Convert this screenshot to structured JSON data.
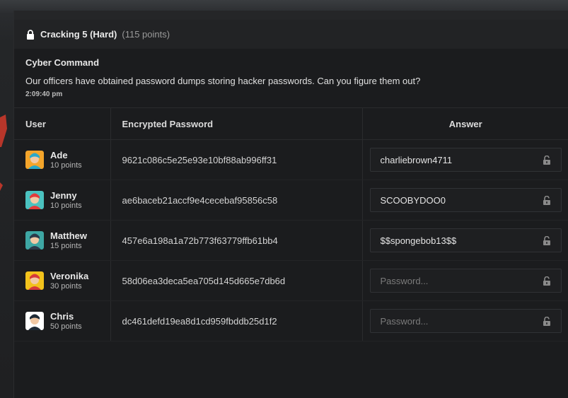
{
  "challenge": {
    "title": "Cracking 5 (Hard)",
    "points": "(115 points)",
    "author": "Cyber Command",
    "message": "Our officers have obtained password dumps storing hacker passwords. Can you figure them out?",
    "time": "2:09:40 pm"
  },
  "table": {
    "headers": {
      "user": "User",
      "password": "Encrypted Password",
      "answer": "Answer"
    },
    "rows": [
      {
        "name": "Ade",
        "points": "10 points",
        "hash": "9621c086c5e25e93e10bf88ab996ff31",
        "answer": "charliebrown4711",
        "placeholder": "Password...",
        "avatar_bg": "#f4a52b",
        "avatar_hair": "#2aa8c9"
      },
      {
        "name": "Jenny",
        "points": "10 points",
        "hash": "ae6baceb21accf9e4cecebaf95856c58",
        "answer": "SCOOBYDOO0",
        "placeholder": "Password...",
        "avatar_bg": "#4bc2c0",
        "avatar_hair": "#e23b3b"
      },
      {
        "name": "Matthew",
        "points": "15 points",
        "hash": "457e6a198a1a72b773f63779ffb61bb4",
        "answer": "$$spongebob13$$",
        "placeholder": "Password...",
        "avatar_bg": "#3ea7a4",
        "avatar_hair": "#2b3a4a"
      },
      {
        "name": "Veronika",
        "points": "30 points",
        "hash": "58d06ea3deca5ea705d145d665e7db6d",
        "answer": "",
        "placeholder": "Password...",
        "avatar_bg": "#f2c21c",
        "avatar_hair": "#d63a3a"
      },
      {
        "name": "Chris",
        "points": "50 points",
        "hash": "dc461defd19ea8d1cd959fbddb25d1f2",
        "answer": "",
        "placeholder": "Password...",
        "avatar_bg": "#ffffff",
        "avatar_hair": "#1e2a36"
      }
    ]
  },
  "colors": {
    "lock": "#ffffff",
    "unlock": "#8a8a8a",
    "accent_red": "#c0392b"
  },
  "icons": {
    "title": "lock-icon",
    "answer": "unlock-icon"
  }
}
